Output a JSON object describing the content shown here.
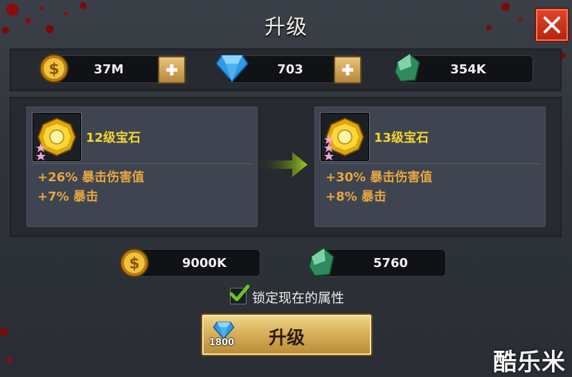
{
  "title": "升级",
  "resources": {
    "gold": "37M",
    "diamond": "703",
    "stone": "354K"
  },
  "current_gem": {
    "name": "12级宝石",
    "stats": [
      "+26% 暴击伤害值",
      "+7% 暴击"
    ]
  },
  "next_gem": {
    "name": "13级宝石",
    "stats": [
      "+30% 暴击伤害值",
      "+8% 暴击"
    ]
  },
  "cost": {
    "gold": "9000K",
    "stone": "5760"
  },
  "lock_attributes": {
    "label": "锁定现在的属性",
    "checked": true
  },
  "upgrade_button": {
    "label": "升级",
    "diamond_cost": "1800"
  },
  "watermark": "酷乐米",
  "colors": {
    "gem_name": "#f3d531",
    "stat_text": "#e6a640",
    "close_button": "#d33a22",
    "upgrade_button": "#d8b05b"
  }
}
